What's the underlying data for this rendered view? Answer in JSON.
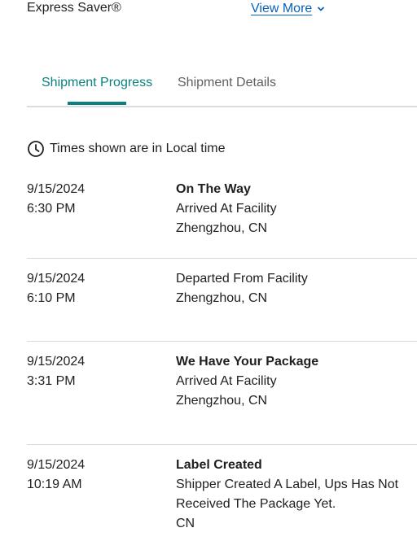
{
  "service": {
    "name": "Express Saver®",
    "view_more_label": "View More"
  },
  "tabs": [
    {
      "label": "Shipment Progress",
      "active": true
    },
    {
      "label": "Shipment Details",
      "active": false
    }
  ],
  "timezone_note": "Times shown are in Local time",
  "events": [
    {
      "date": "9/15/2024",
      "time": "6:30 PM",
      "status": "On The Way",
      "description": "Arrived At Facility",
      "location": "Zhengzhou, CN"
    },
    {
      "date": "9/15/2024",
      "time": "6:10 PM",
      "status": "",
      "description": "Departed From Facility",
      "location": "Zhengzhou, CN"
    },
    {
      "date": "9/15/2024",
      "time": "3:31 PM",
      "status": "We Have Your Package",
      "description": "Arrived At Facility",
      "location": "Zhengzhou, CN"
    },
    {
      "date": "9/15/2024",
      "time": "10:19 AM",
      "status": "Label Created",
      "description": "Shipper Created A Label, Ups Has Not Received The Package Yet.",
      "location": "CN"
    }
  ],
  "colors": {
    "accent": "#0a8080",
    "link": "#0662bb",
    "divider": "#d9d9d9"
  },
  "icons": {
    "view_more": "chevron-down-icon",
    "timezone": "clock-icon"
  }
}
